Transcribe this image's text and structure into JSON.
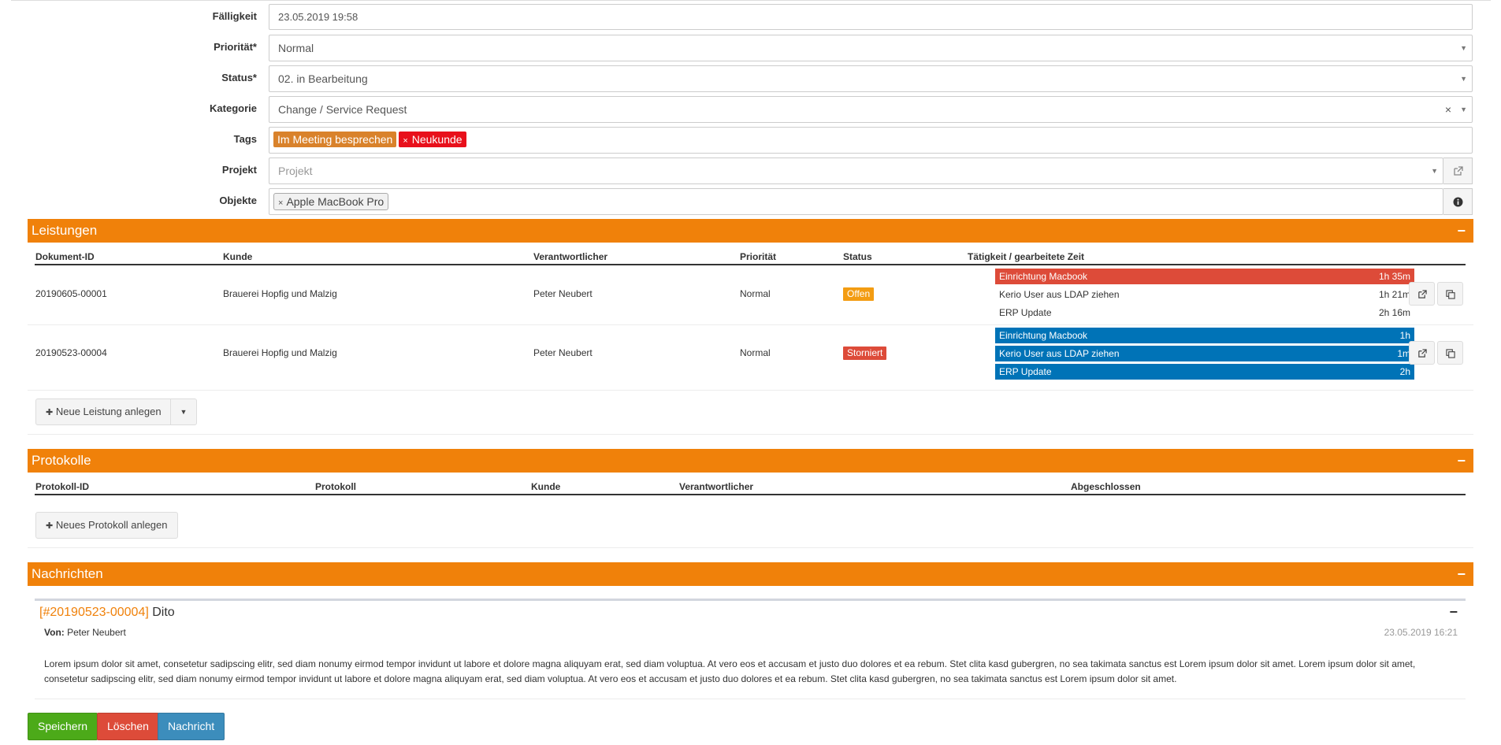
{
  "form": {
    "faelligkeit": {
      "label": "Fälligkeit",
      "value": "23.05.2019 19:58"
    },
    "prioritaet": {
      "label": "Priorität*",
      "value": "Normal"
    },
    "status": {
      "label": "Status*",
      "value": "02. in Bearbeitung"
    },
    "kategorie": {
      "label": "Kategorie",
      "value": "Change / Service Request",
      "clear": "×"
    },
    "tags": {
      "label": "Tags",
      "items": [
        {
          "label": "Im Meeting besprechen",
          "color": "#d9822b"
        },
        {
          "label": "Neukunde",
          "color": "#e8101b",
          "remove": "×"
        }
      ]
    },
    "projekt": {
      "label": "Projekt",
      "placeholder": "Projekt"
    },
    "objekte": {
      "label": "Objekte",
      "items": [
        {
          "label": "Apple MacBook Pro",
          "remove": "×"
        }
      ]
    },
    "select_arrow": "▼",
    "icons": {
      "external_link": "external-link-icon",
      "info": "info-icon"
    }
  },
  "leistungen": {
    "title": "Leistungen",
    "collapse": "−",
    "columns": [
      "Dokument-ID",
      "Kunde",
      "Verantwortlicher",
      "Priorität",
      "Status",
      "Tätigkeit / gearbeitete Zeit"
    ],
    "rows": [
      {
        "id": "20190605-00001",
        "kunde": "Brauerei Hopfig und Malzig",
        "verantwortlicher": "Peter Neubert",
        "prioritaet": "Normal",
        "status": "Offen",
        "status_color": "#f39c12",
        "activities": [
          {
            "name": "Einrichtung Macbook",
            "time": "1h 35m",
            "style": "red"
          },
          {
            "name": "Kerio User aus LDAP ziehen",
            "time": "1h 21m",
            "style": "plain"
          },
          {
            "name": "ERP Update",
            "time": "2h 16m",
            "style": "plain"
          }
        ]
      },
      {
        "id": "20190523-00004",
        "kunde": "Brauerei Hopfig und Malzig",
        "verantwortlicher": "Peter Neubert",
        "prioritaet": "Normal",
        "status": "Storniert",
        "status_color": "#dd4b39",
        "activities": [
          {
            "name": "Einrichtung Macbook",
            "time": "1h",
            "style": "blue"
          },
          {
            "name": "Kerio User aus LDAP ziehen",
            "time": "1m",
            "style": "blue"
          },
          {
            "name": "ERP Update",
            "time": "2h",
            "style": "blue"
          }
        ]
      }
    ],
    "new_button": "Neue Leistung anlegen",
    "plus": "✚",
    "caret": "▼"
  },
  "protokolle": {
    "title": "Protokolle",
    "collapse": "−",
    "columns": [
      "Protokoll-ID",
      "Protokoll",
      "Kunde",
      "Verantwortlicher",
      "Abgeschlossen"
    ],
    "new_button": "Neues Protokoll anlegen",
    "plus": "✚"
  },
  "nachrichten": {
    "title": "Nachrichten",
    "collapse": "−",
    "message": {
      "ref": "[#20190523-00004]",
      "subject": "Dito",
      "from_label": "Von:",
      "from": "Peter Neubert",
      "date": "23.05.2019 16:21",
      "collapse": "−",
      "body": "Lorem ipsum dolor sit amet, consetetur sadipscing elitr, sed diam nonumy eirmod tempor invidunt ut labore et dolore magna aliquyam erat, sed diam voluptua. At vero eos et accusam et justo duo dolores et ea rebum. Stet clita kasd gubergren, no sea takimata sanctus est Lorem ipsum dolor sit amet. Lorem ipsum dolor sit amet, consetetur sadipscing elitr, sed diam nonumy eirmod tempor invidunt ut labore et dolore magna aliquyam erat, sed diam voluptua. At vero eos et accusam et justo duo dolores et ea rebum. Stet clita kasd gubergren, no sea takimata sanctus est Lorem ipsum dolor sit amet."
    }
  },
  "actions": {
    "save": "Speichern",
    "delete": "Löschen",
    "message": "Nachricht"
  },
  "colors": {
    "accent": "#f0810a",
    "save": "#4caa19",
    "delete": "#dd4b39",
    "message": "#3c8dbc"
  }
}
